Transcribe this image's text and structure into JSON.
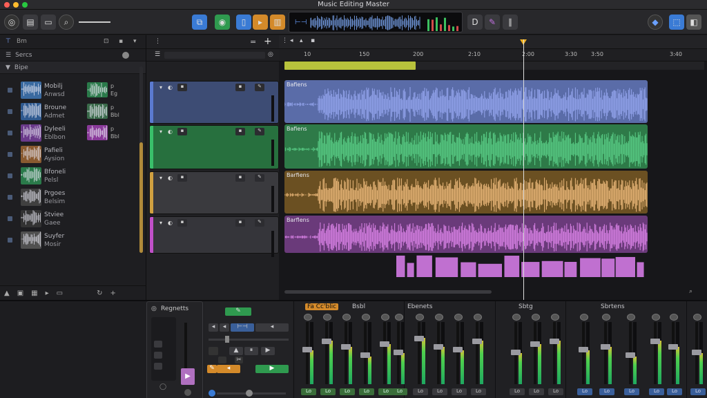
{
  "window": {
    "title": "Music Editing Master",
    "traffic_colors": [
      "#ff5f57",
      "#febc2e",
      "#28c840"
    ]
  },
  "toolbar": {
    "left_icons": [
      "metronome-icon",
      "library-icon",
      "folder-icon",
      "search-icon",
      "arrow-line-icon"
    ],
    "center_icons": [
      "copy-icon",
      "smart-controls-icon",
      "notepad-icon",
      "forward-icon",
      "score-icon"
    ],
    "right_icons": [
      "tuner-icon",
      "edit-icon",
      "settings-icon",
      "cpu-icon",
      "share-icon",
      "fullscreen-icon"
    ],
    "lcd_label": "Waveform Overview"
  },
  "browser": {
    "tab_label": "Bm",
    "section_label": "Sercs",
    "folder_label": "Bipe",
    "items": [
      {
        "name1": "Mobilj",
        "name2": "Anwsd",
        "side1": "p",
        "side2": "Eg"
      },
      {
        "name1": "Broune",
        "name2": "Admet",
        "side1": "p",
        "side2": "Bbl"
      },
      {
        "name1": "Dyleeli",
        "name2": "Eblbon",
        "side1": "p",
        "side2": "Bbl"
      },
      {
        "name1": "Pafieli",
        "name2": "Aysion",
        "side1": "",
        "side2": ""
      },
      {
        "name1": "Bfoneli",
        "name2": "Pelsl",
        "side1": "",
        "side2": ""
      },
      {
        "name1": "Prgoes",
        "name2": "Belsim",
        "side1": "",
        "side2": ""
      },
      {
        "name1": "Stviee",
        "name2": "Gaee",
        "side1": "",
        "side2": ""
      },
      {
        "name1": "Suyfer",
        "name2": "Mosir",
        "side1": "",
        "side2": ""
      }
    ]
  },
  "ruler": {
    "ticks": [
      "10",
      "150",
      "200",
      "2:10",
      "2:00",
      "3:30",
      "3:50",
      "3:40"
    ]
  },
  "tracks": [
    {
      "region_name": "Bafiens",
      "color": "#5a6ca8",
      "wave": "#8fa0e8",
      "header": "#3d4c74",
      "stripe": "#5b7ad0"
    },
    {
      "region_name": "Bafiens",
      "color": "#2e7a48",
      "wave": "#56c882",
      "header": "#27703e",
      "stripe": "#39c06a"
    },
    {
      "region_name": "Barfiens",
      "color": "#6b5022",
      "wave": "#e4b274",
      "header": "#3a3a3e",
      "stripe": "#d0a040"
    },
    {
      "region_name": "Barflens",
      "color": "#6a3a7a",
      "wave": "#d37ee0",
      "header": "#35353a",
      "stripe": "#c050c8"
    }
  ],
  "mixer": {
    "inspector_title": "Regnetts",
    "groups": [
      {
        "title": "Fa Cc'blic",
        "highlight": true
      },
      {
        "title": "Bsbl",
        "highlight": false
      },
      {
        "title": "Ebenets",
        "highlight": false
      },
      {
        "title": "Sbtg",
        "highlight": false
      },
      {
        "title": "Sbrtens",
        "highlight": false
      }
    ],
    "channel_levels": [
      0.55,
      0.7,
      0.6,
      0.45,
      0.65,
      0.5,
      0.75,
      0.6,
      0.55,
      0.7,
      0.5,
      0.65,
      0.7,
      0.55,
      0.6,
      0.45,
      0.7,
      0.6,
      0.5,
      0.65
    ],
    "channel_btns": [
      "Lo",
      "Lo",
      "Lo",
      "Lo",
      "Lo",
      "Lo",
      "Lo",
      "Lo",
      "Lo",
      "Lo",
      "Lo",
      "Lo",
      "Lo",
      "Lo",
      "Lo",
      "Lo",
      "Lo",
      "Lo",
      "Lo",
      "Lo"
    ]
  },
  "colors": {
    "accent_blue": "#3a7bd5",
    "accent_green": "#2f9a4f",
    "accent_orange": "#d48a2a",
    "cycle": "#b8c23c",
    "playhead_cap": "#f0b020"
  }
}
